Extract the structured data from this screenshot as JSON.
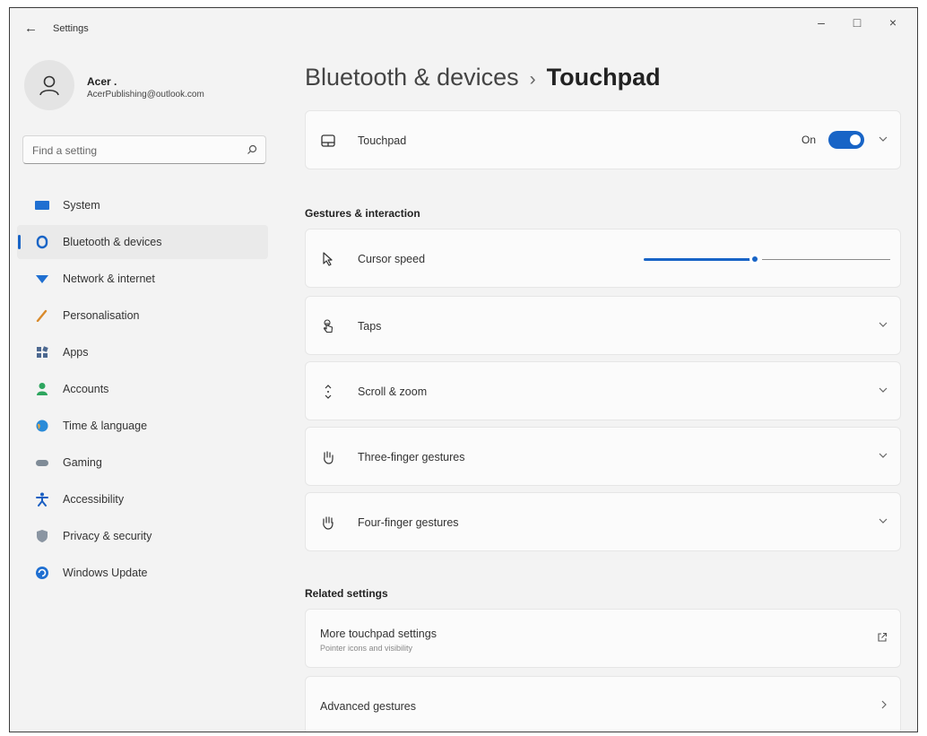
{
  "window": {
    "title": "Settings",
    "back_glyph": "←",
    "minimize": "–",
    "maximize": "□",
    "close": "×"
  },
  "profile": {
    "name": "Acer .",
    "email": "AcerPublishing@outlook.com",
    "icon": "user-avatar-icon"
  },
  "search": {
    "placeholder": "Find a setting",
    "value": ""
  },
  "sidebar": {
    "items": [
      {
        "label": "System",
        "icon": "system-icon",
        "color": "#1f6fd1",
        "active": false
      },
      {
        "label": "Bluetooth & devices",
        "icon": "bluetooth-icon",
        "color": "#1864c6",
        "active": true
      },
      {
        "label": "Network & internet",
        "icon": "network-icon",
        "color": "#1f6fd1",
        "active": false
      },
      {
        "label": "Personalisation",
        "icon": "brush-icon",
        "color": "#d98a2b",
        "active": false
      },
      {
        "label": "Apps",
        "icon": "apps-icon",
        "color": "#4c6890",
        "active": false
      },
      {
        "label": "Accounts",
        "icon": "accounts-icon",
        "color": "#2da55e",
        "active": false
      },
      {
        "label": "Time & language",
        "icon": "globe-icon",
        "color": "#2a8bd8",
        "active": false
      },
      {
        "label": "Gaming",
        "icon": "gamepad-icon",
        "color": "#7f8b97",
        "active": false
      },
      {
        "label": "Accessibility",
        "icon": "accessibility-icon",
        "color": "#1a5fc2",
        "active": false
      },
      {
        "label": "Privacy & security",
        "icon": "shield-icon",
        "color": "#8a95a2",
        "active": false
      },
      {
        "label": "Windows Update",
        "icon": "update-icon",
        "color": "#1f6fd1",
        "active": false
      }
    ]
  },
  "breadcrumb": {
    "parent": "Bluetooth & devices",
    "separator": "›",
    "current": "Touchpad"
  },
  "touchpad_card": {
    "label": "Touchpad",
    "state_label": "On",
    "enabled": true
  },
  "gestures_section": {
    "title": "Gestures & interaction"
  },
  "cursor_speed": {
    "label": "Cursor speed",
    "value_fraction": 0.45
  },
  "expanders": [
    {
      "label": "Taps",
      "icon": "tap-icon"
    },
    {
      "label": "Scroll & zoom",
      "icon": "scroll-icon"
    },
    {
      "label": "Three-finger gestures",
      "icon": "three-finger-icon"
    },
    {
      "label": "Four-finger gestures",
      "icon": "four-finger-icon"
    }
  ],
  "related_section": {
    "title": "Related settings"
  },
  "more_touchpad": {
    "label": "More touchpad settings",
    "sublabel": "Pointer icons and visibility"
  },
  "advanced_gestures": {
    "label": "Advanced gestures"
  },
  "accent_color": "#1864c6"
}
